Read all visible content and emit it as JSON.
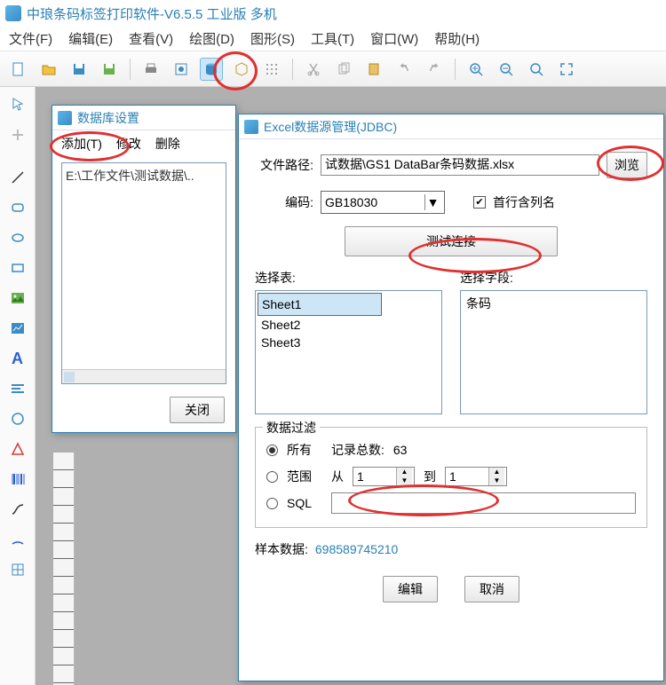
{
  "app": {
    "title": "中琅条码标签打印软件-V6.5.5 工业版 多机"
  },
  "menu": {
    "file": "文件(F)",
    "edit": "编辑(E)",
    "view": "查看(V)",
    "draw": "绘图(D)",
    "shape": "图形(S)",
    "tool": "工具(T)",
    "window": "窗口(W)",
    "help": "帮助(H)"
  },
  "dbDialog": {
    "title": "数据库设置",
    "add": "添加(T)",
    "modify": "修改",
    "delete": "删除",
    "item": "E:\\工作文件\\测试数据\\..",
    "close": "关闭"
  },
  "excelDialog": {
    "title": "Excel数据源管理(JDBC)",
    "pathLabel": "文件路径:",
    "pathValue": "试数据\\GS1 DataBar条码数据.xlsx",
    "browse": "浏览",
    "encodingLabel": "编码:",
    "encodingValue": "GB18030",
    "firstRowHeader": "首行含列名",
    "testConn": "测试连接",
    "selectTable": "选择表:",
    "selectField": "选择字段:",
    "sheets": [
      "Sheet1",
      "Sheet2",
      "Sheet3"
    ],
    "field": "条码",
    "filterLegend": "数据过滤",
    "radioAll": "所有",
    "recordCountLabel": "记录总数:",
    "recordCount": "63",
    "radioRange": "范围",
    "fromLabel": "从",
    "toLabel": "到",
    "fromVal": "1",
    "toVal": "1",
    "radioSQL": "SQL",
    "sampleLabel": "样本数据:",
    "sampleValue": "698589745210",
    "editBtn": "编辑",
    "cancelBtn": "取消"
  }
}
